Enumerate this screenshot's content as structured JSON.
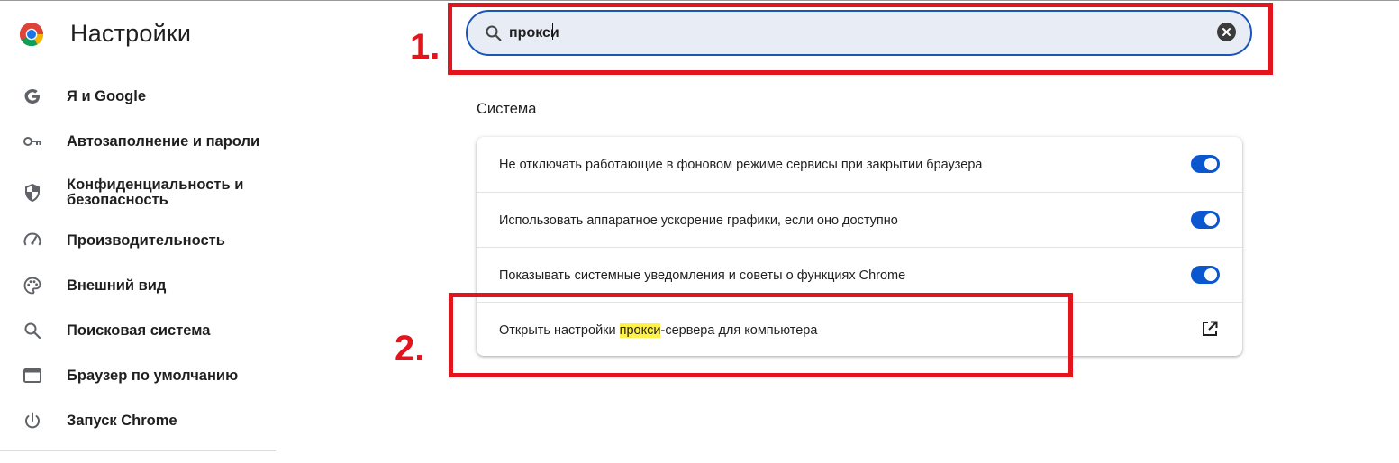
{
  "header": {
    "title": "Настройки",
    "logo": "chrome-logo"
  },
  "sidebar": {
    "items": [
      {
        "label": "Я и Google",
        "icon": "google-g-icon"
      },
      {
        "label": "Автозаполнение и пароли",
        "icon": "key-icon"
      },
      {
        "label": "Конфиденциальность и безопасность",
        "icon": "shield-icon"
      },
      {
        "label": "Производительность",
        "icon": "speedometer-icon"
      },
      {
        "label": "Внешний вид",
        "icon": "palette-icon"
      },
      {
        "label": "Поисковая система",
        "icon": "search-icon"
      },
      {
        "label": "Браузер по умолчанию",
        "icon": "browser-window-icon"
      },
      {
        "label": "Запуск Chrome",
        "icon": "power-icon"
      }
    ]
  },
  "search": {
    "value": "прокси",
    "placeholder": ""
  },
  "section": {
    "title": "Система",
    "rows": [
      {
        "label": "Не отключать работающие в фоновом режиме сервисы при закрытии браузера",
        "control": "toggle",
        "on": true
      },
      {
        "label": "Использовать аппаратное ускорение графики, если оно доступно",
        "control": "toggle",
        "on": true
      },
      {
        "label": "Показывать системные уведомления и советы о функциях Chrome",
        "control": "toggle",
        "on": true
      },
      {
        "label_before": "Открыть настройки ",
        "label_highlight": "прокси",
        "label_after": "-сервера для компьютера",
        "control": "external-link"
      }
    ]
  },
  "annotations": {
    "one": "1.",
    "two": "2."
  },
  "colors": {
    "accent": "#0b57d0",
    "annotation": "#e3141c",
    "highlight": "#fff04a",
    "search_bg": "#e8ecf4"
  }
}
